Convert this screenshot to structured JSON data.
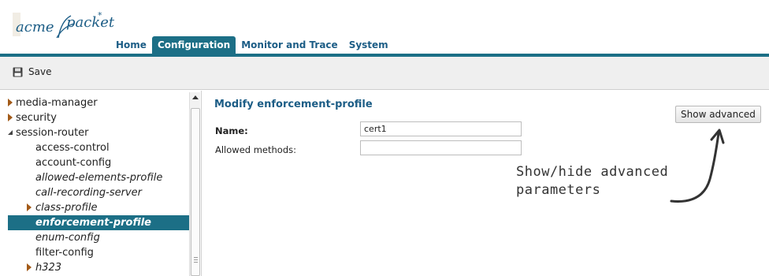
{
  "header": {
    "logo": {
      "acme": "acme",
      "packet": "packet"
    },
    "nav": [
      {
        "label": "Home"
      },
      {
        "label": "Configuration",
        "active": true
      },
      {
        "label": "Monitor and Trace"
      },
      {
        "label": "System"
      }
    ]
  },
  "toolbar": {
    "save_label": "Save",
    "save_icon": "floppy-disk-icon"
  },
  "sidebar": {
    "items": [
      {
        "label": "media-manager",
        "level": 0,
        "expander": "collapsed"
      },
      {
        "label": "security",
        "level": 0,
        "expander": "collapsed"
      },
      {
        "label": "session-router",
        "level": 0,
        "expander": "expanded"
      },
      {
        "label": "access-control",
        "level": 1
      },
      {
        "label": "account-config",
        "level": 1
      },
      {
        "label": "allowed-elements-profile",
        "level": 1,
        "italic": true
      },
      {
        "label": "call-recording-server",
        "level": 1,
        "italic": true
      },
      {
        "label": "class-profile",
        "level": 1,
        "italic": true,
        "expander": "collapsed"
      },
      {
        "label": "enforcement-profile",
        "level": 1,
        "italic": true,
        "selected": true
      },
      {
        "label": "enum-config",
        "level": 1,
        "italic": true
      },
      {
        "label": "filter-config",
        "level": 1
      },
      {
        "label": "h323",
        "level": 1,
        "italic": true,
        "expander": "collapsed"
      }
    ]
  },
  "main": {
    "title": "Modify enforcement-profile",
    "fields": [
      {
        "label": "Name:",
        "value": "cert1",
        "bold": true
      },
      {
        "label": "Allowed methods:",
        "value": "",
        "bold": false
      }
    ],
    "show_advanced_label": "Show advanced",
    "annotation": {
      "line1": "Show/hide advanced",
      "line2": "parameters"
    }
  },
  "colors": {
    "brand": "#1c6f86",
    "title": "#1c5d86",
    "tree_arrow": "#a25a18"
  }
}
